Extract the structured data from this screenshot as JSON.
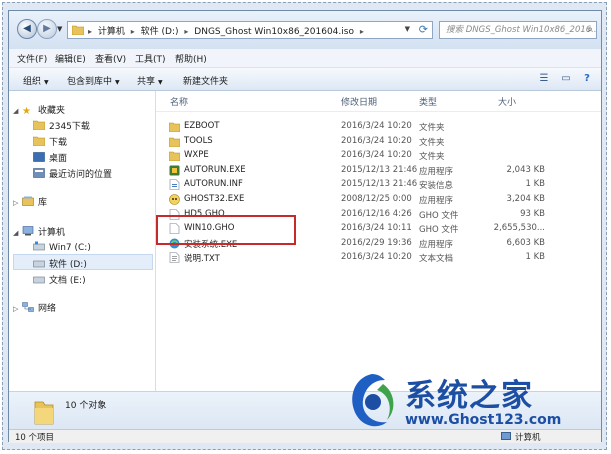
{
  "address": {
    "crumbs": [
      "计算机",
      "软件 (D:)",
      "DNGS_Ghost Win10x86_201604.iso"
    ],
    "search_placeholder": "搜索 DNGS_Ghost Win10x86_2016..."
  },
  "menu": [
    "文件(F)",
    "编辑(E)",
    "查看(V)",
    "工具(T)",
    "帮助(H)"
  ],
  "toolbar": {
    "organize": "组织",
    "include_in_library": "包含到库中",
    "share": "共享",
    "new_folder": "新建文件夹"
  },
  "nav": {
    "favorites": "收藏夹",
    "favorites_items": [
      "2345下载",
      "下载",
      "桌面",
      "最近访问的位置"
    ],
    "libraries": "库",
    "computer": "计算机",
    "drives": [
      "Win7 (C:)",
      "软件 (D:)",
      "文档 (E:)"
    ],
    "network": "网络"
  },
  "columns": {
    "name": "名称",
    "date": "修改日期",
    "type": "类型",
    "size": "大小"
  },
  "files": [
    {
      "name": "EZBOOT",
      "date": "2016/3/24 10:20",
      "type": "文件夹",
      "size": "",
      "icon": "folder-icon"
    },
    {
      "name": "TOOLS",
      "date": "2016/3/24 10:20",
      "type": "文件夹",
      "size": "",
      "icon": "folder-icon"
    },
    {
      "name": "WXPE",
      "date": "2016/3/24 10:20",
      "type": "文件夹",
      "size": "",
      "icon": "folder-icon"
    },
    {
      "name": "AUTORUN.EXE",
      "date": "2015/12/13 21:46",
      "type": "应用程序",
      "size": "2,043 KB",
      "icon": "autorun-exe-icon"
    },
    {
      "name": "AUTORUN.INF",
      "date": "2015/12/13 21:46",
      "type": "安装信息",
      "size": "1 KB",
      "icon": "inf-file-icon"
    },
    {
      "name": "GHOST32.EXE",
      "date": "2008/12/25 0:00",
      "type": "应用程序",
      "size": "3,204 KB",
      "icon": "ghost-exe-icon"
    },
    {
      "name": "HD5.GHO",
      "date": "2016/12/16 4:26",
      "type": "GHO 文件",
      "size": "93 KB",
      "icon": "file-icon"
    },
    {
      "name": "WIN10.GHO",
      "date": "2016/3/24 10:11",
      "type": "GHO 文件",
      "size": "2,655,530...",
      "icon": "file-icon"
    },
    {
      "name": "安装系统.EXE",
      "date": "2016/2/29 19:36",
      "type": "应用程序",
      "size": "6,603 KB",
      "icon": "installer-exe-icon"
    },
    {
      "name": "说明.TXT",
      "date": "2016/3/24 10:20",
      "type": "文本文档",
      "size": "1 KB",
      "icon": "text-file-icon"
    }
  ],
  "details": {
    "count": "10 个对象"
  },
  "status": {
    "items": "10 个项目",
    "location": "计算机"
  },
  "watermark": {
    "title": "系统之家",
    "url": "www.Ghost123.com"
  },
  "colors": {
    "highlight_box": "#c62b2b",
    "watermark_blue": "#1c4fa3"
  }
}
